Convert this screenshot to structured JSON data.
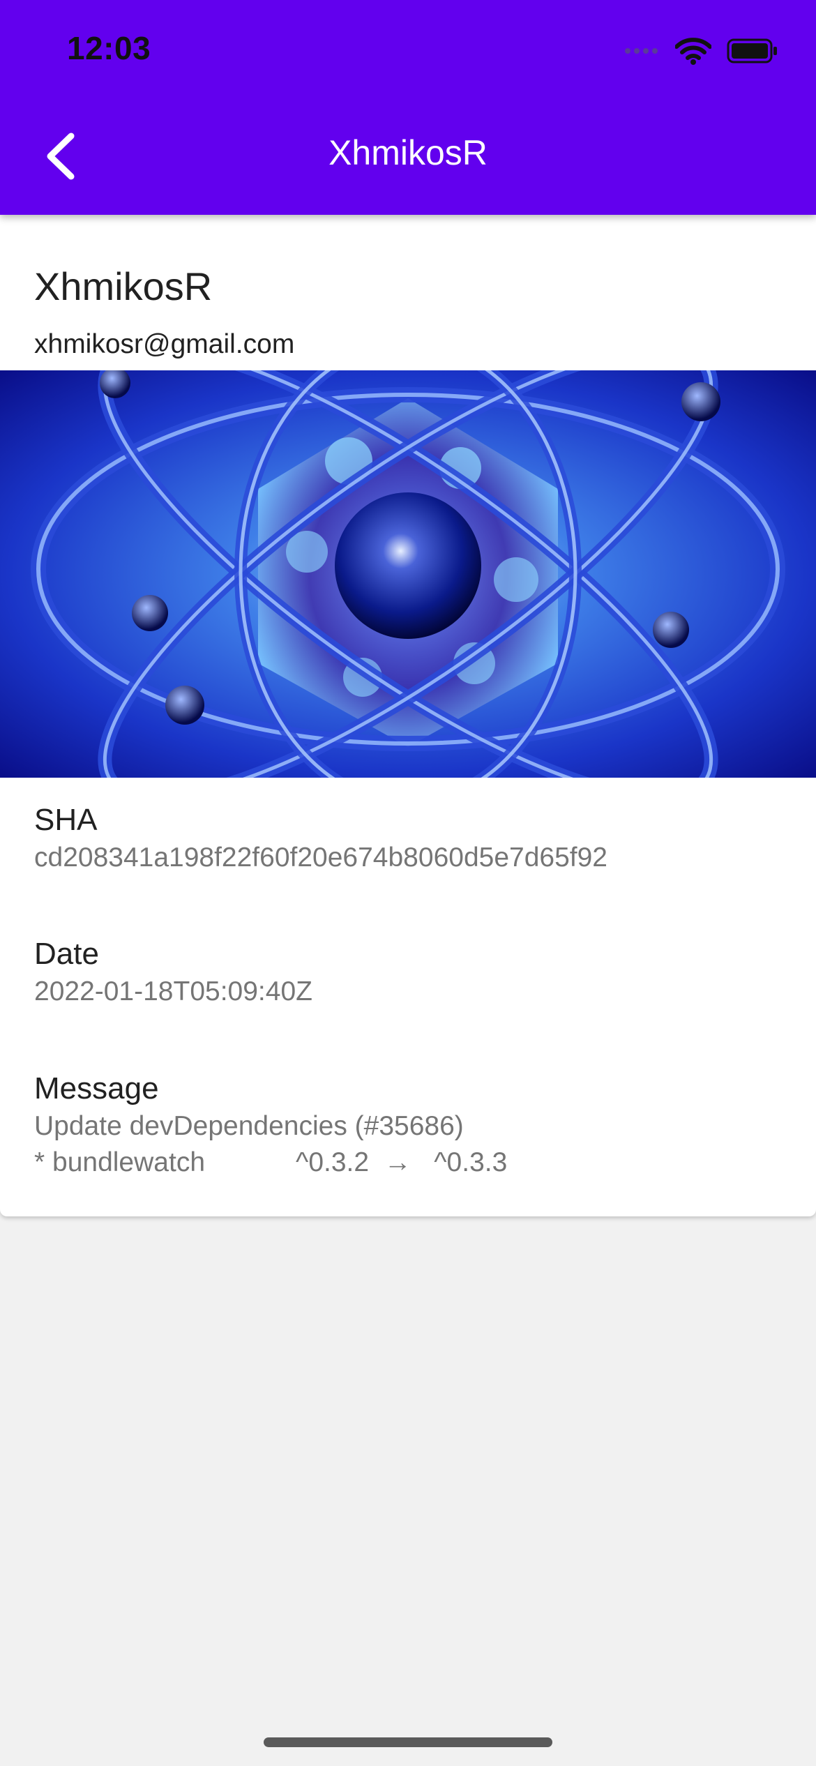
{
  "status_bar": {
    "time": "12:03"
  },
  "app_bar": {
    "title": "XhmikosR"
  },
  "author": {
    "name": "XhmikosR",
    "email": "xhmikosr@gmail.com"
  },
  "details": {
    "sha_label": "SHA",
    "sha_value": "cd208341a198f22f60f20e674b8060d5e7d65f92",
    "date_label": "Date",
    "date_value": "2022-01-18T05:09:40Z",
    "message_label": "Message",
    "message_line1": "Update devDependencies (#35686)",
    "message_line2": "* bundlewatch            ^0.3.2  →   ^0.3.3"
  },
  "colors": {
    "app_bar": "#6200ee",
    "background": "#f1f1f1",
    "card": "#ffffff",
    "secondary_text": "#757575"
  },
  "icons": [
    "signal-icon",
    "wifi-icon",
    "battery-icon",
    "back-arrow-icon"
  ]
}
